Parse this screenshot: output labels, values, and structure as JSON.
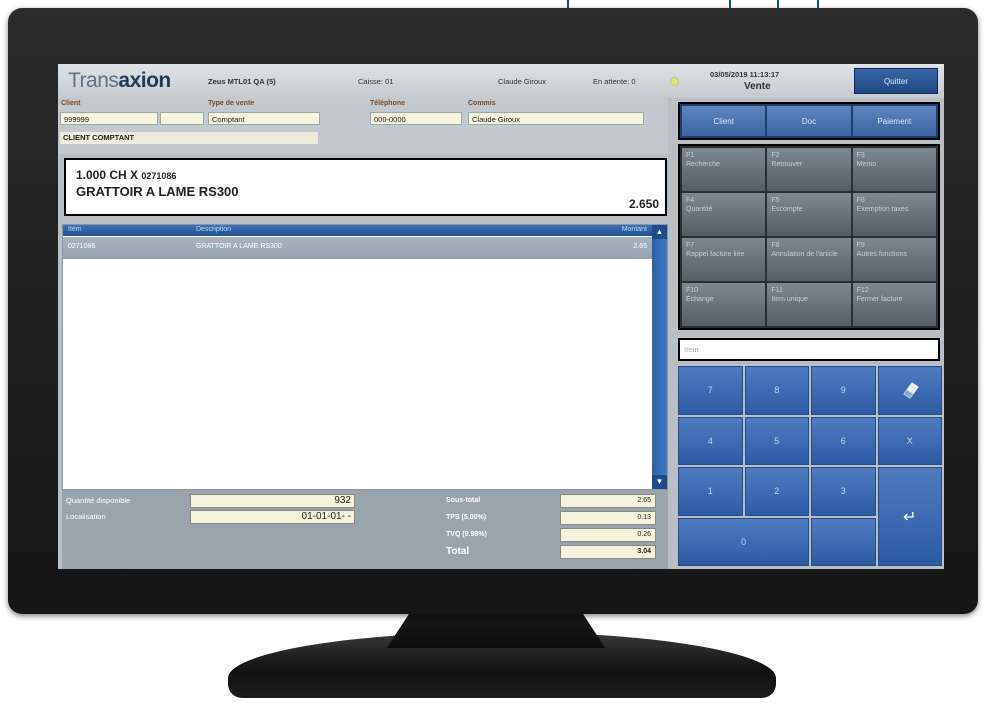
{
  "header": {
    "logo_prefix": "Trans",
    "logo_bold": "axion",
    "station": "Zeus MTL01 QA (5)",
    "register": "Caisse: 01",
    "user": "Claude Giroux",
    "waiting": "En attente: 0",
    "datetime": "03/05/2019 11:13:17",
    "mode": "Vente",
    "quit_label": "Quitter"
  },
  "customer": {
    "client_label": "Client",
    "client_number": "999999",
    "sale_type_label": "Type de vente",
    "sale_type": "Comptant",
    "phone_label": "Téléphone",
    "phone": "000-0000",
    "clerk_label": "Commis",
    "clerk": "Claude Giroux",
    "client_name": "CLIENT COMPTANT"
  },
  "scan": {
    "qty_text": "1.000 CH X ",
    "item_code": "0271086",
    "description": "GRATTOIR A LAME RS300",
    "amount": "2.650"
  },
  "grid": {
    "col_item": "Item",
    "col_description": "Description",
    "col_amount": "Montant",
    "rows": [
      {
        "item": "0271086",
        "description": "GRATTOIR A LAME RS300",
        "amount": "2.65"
      }
    ]
  },
  "summary": {
    "qty_label": "Quantité disponible",
    "qty_value": "932",
    "location_label": "Localisation",
    "location_value": "01-01-01- -",
    "subtotal_label": "Sous-total",
    "subtotal_value": "2.65",
    "tps_label": "TPS (5.00%)",
    "tps_value": "0.13",
    "tvq_label": "TVQ (9.98%)",
    "tvq_value": "0.26",
    "total_label": "Total",
    "total_value": "3.04"
  },
  "tabs": [
    "Client",
    "Doc",
    "Paiement"
  ],
  "function_keys": [
    {
      "key": "F1",
      "label": "Recherche"
    },
    {
      "key": "F2",
      "label": "Retrouver"
    },
    {
      "key": "F3",
      "label": "Memo"
    },
    {
      "key": "F4",
      "label": "Quantité"
    },
    {
      "key": "F5",
      "label": "Escompte"
    },
    {
      "key": "F6",
      "label": "Exemption taxes"
    },
    {
      "key": "F7",
      "label": "Rappel facture liée"
    },
    {
      "key": "F8",
      "label": "Annulation de l'article"
    },
    {
      "key": "F9",
      "label": "Autres fonctions"
    },
    {
      "key": "F10",
      "label": "Échange"
    },
    {
      "key": "F11",
      "label": "Item unique"
    },
    {
      "key": "F12",
      "label": "Fermer facture"
    }
  ],
  "search_placeholder": "Item",
  "keypad": {
    "k7": "7",
    "k8": "8",
    "k9": "9",
    "clear_icon": "eraser-icon",
    "k4": "4",
    "k5": "5",
    "k6": "6",
    "kx": "X",
    "k1": "1",
    "k2": "2",
    "k3": "3",
    "enter": "↵",
    "k0": "0",
    "kblank": ""
  },
  "colors": {
    "accent_blue": "#2d5ba3",
    "callout": "#0d4f7e",
    "field_bg": "#f6f3dc"
  }
}
